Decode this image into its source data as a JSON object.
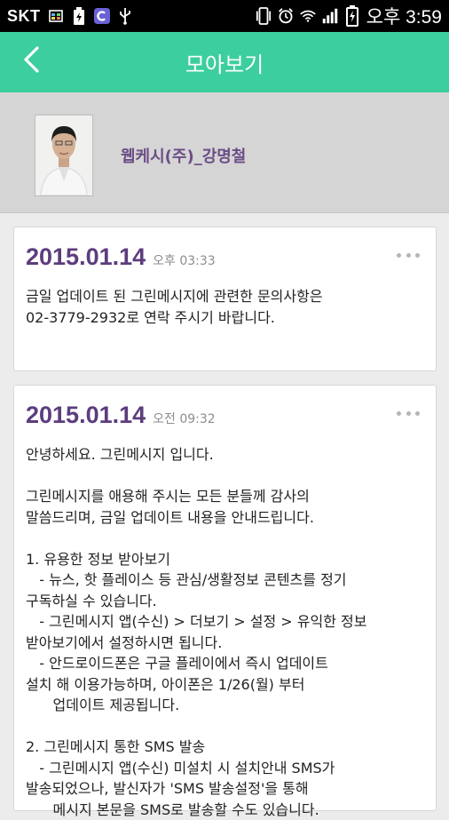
{
  "status_bar": {
    "carrier": "SKT",
    "time": "오후 3:59",
    "icons": [
      "photo-icon",
      "battery-saver-icon",
      "app-c-icon",
      "usb-icon",
      "vibrate-icon",
      "alarm-icon",
      "wifi-icon",
      "signal-icon",
      "battery-charging-icon"
    ]
  },
  "app_bar": {
    "title": "모아보기",
    "back_icon": "chevron-left-icon"
  },
  "colors": {
    "accent": "#3cce9e",
    "name": "#6b4d86",
    "date": "#5c3d7e"
  },
  "profile": {
    "name": "웹케시(주)_강명철"
  },
  "messages": [
    {
      "date": "2015.01.14",
      "time": "오후 03:33",
      "body": "금일 업데이트 된 그린메시지에 관련한 문의사항은\n02-3779-2932로 연락 주시기 바랍니다."
    },
    {
      "date": "2015.01.14",
      "time": "오전 09:32",
      "body": "안녕하세요. 그린메시지 입니다.\n\n그린메시지를 애용해 주시는 모든 분들께 감사의\n말씀드리며, 금일 업데이트 내용을 안내드립니다.\n\n1. 유용한 정보 받아보기\n   - 뉴스, 핫 플레이스 등 관심/생활정보 콘텐츠를 정기\n구독하실 수 있습니다.\n   - 그린메시지 앱(수신) > 더보기 > 설정 > 유익한 정보\n받아보기에서 설정하시면 됩니다.\n   - 안드로이드폰은 구글 플레이에서 즉시 업데이트\n설치 해 이용가능하며, 아이폰은 1/26(월) 부터\n      업데이트 제공됩니다.\n\n2. 그린메시지 통한 SMS 발송\n   - 그린메시지 앱(수신) 미설치 시 설치안내 SMS가\n발송되었으나, 발신자가 'SMS 발송설정'을 통해\n      메시지 본문을 SMS로 발송할 수도 있습니다."
    }
  ]
}
